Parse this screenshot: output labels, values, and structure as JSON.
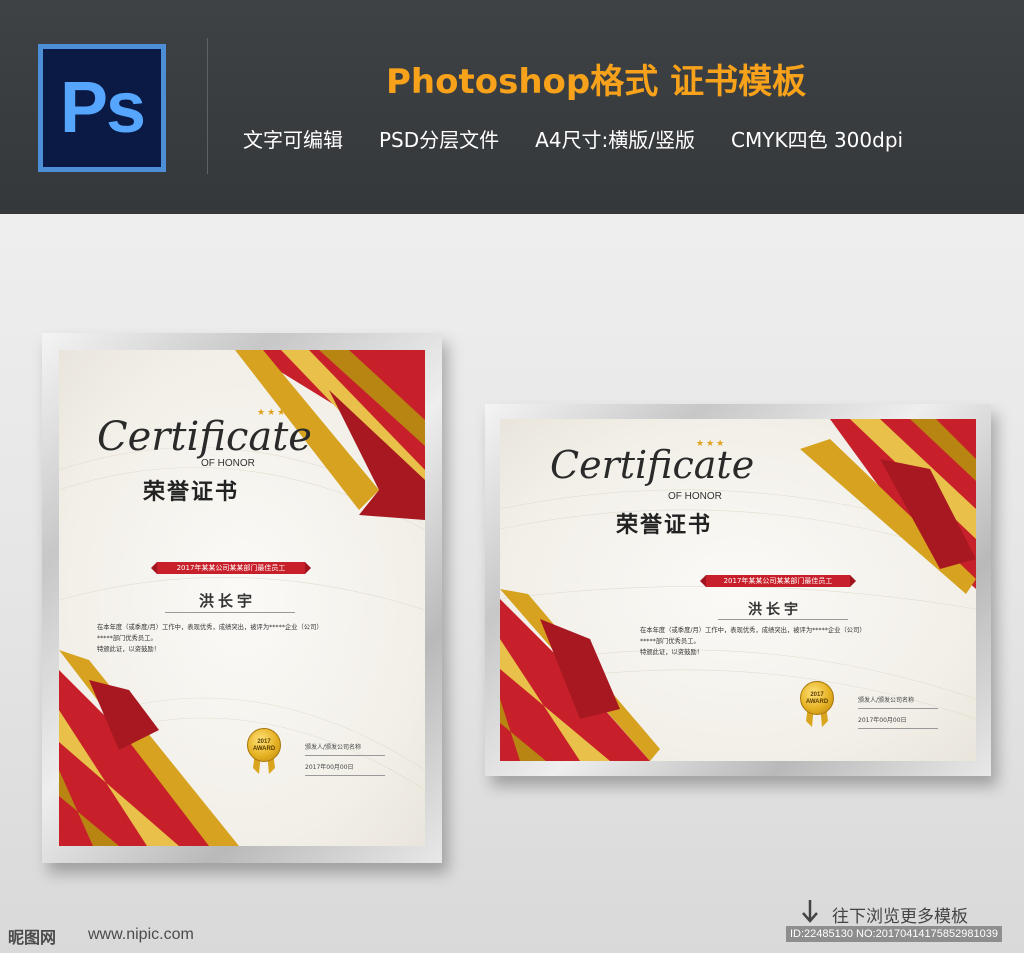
{
  "banner": {
    "logo_text": "Ps",
    "title": "Photoshop格式  证书模板",
    "features": [
      "文字可编辑",
      "PSD分层文件",
      "A4尺寸:横版/竖版",
      "CMYK四色 300dpi"
    ]
  },
  "certificate": {
    "stars": "★★★",
    "script_title": "Certificate",
    "of_honor": "OF HONOR",
    "cn_title": "荣誉证书",
    "ribbon_text": "2017年某某公司某某部门最佳员工",
    "name": "洪长宇",
    "body_lines": [
      "在本年度（或季度/月）工作中，表现优秀，成绩突出，被评为*****企业（公司）",
      "*****部门优秀员工。",
      "特颁此证，以资鼓励！"
    ],
    "seal_year": "2017",
    "seal_label": "AWARD",
    "signer": "颁发人/颁发公司名称",
    "date": "2017年00月00日"
  },
  "footer": {
    "logo_text": "昵图网",
    "url": "www.nipic.com",
    "browse_more": "往下浏览更多模板",
    "id_line": "ID:22485130 NO:20170414175852981039"
  },
  "colors": {
    "accent_orange": "#f7a21a",
    "ribbon_red": "#c8202a",
    "gold": "#e0a21c"
  }
}
